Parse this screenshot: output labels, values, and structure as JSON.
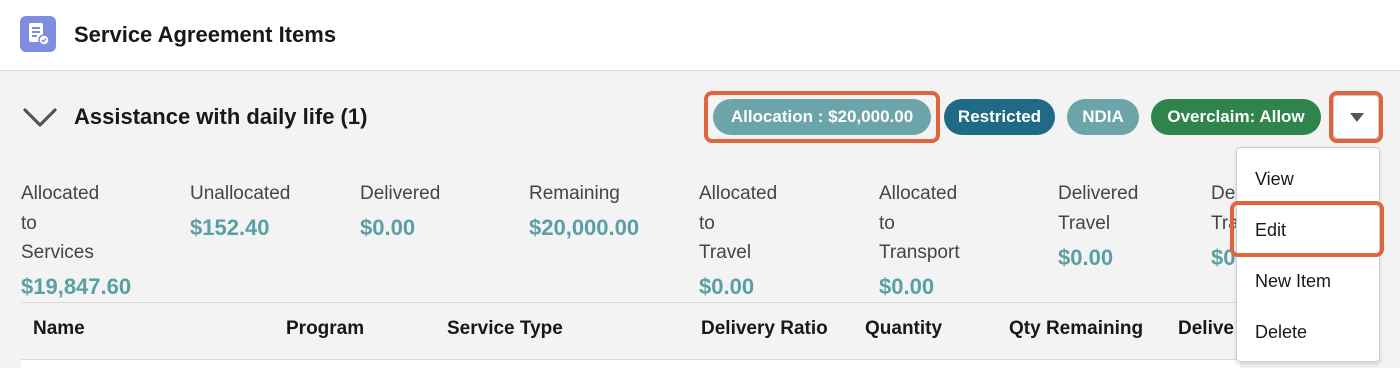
{
  "header": {
    "title": "Service Agreement Items",
    "icon": "service-agreement-icon",
    "icon_color": "#7f8de1"
  },
  "section": {
    "title": "Assistance with daily life (1)"
  },
  "badges": {
    "allocation": "Allocation : $20,000.00",
    "restricted": "Restricted",
    "ndia": "NDIA",
    "overclaim": "Overclaim: Allow"
  },
  "stats": {
    "allocated_services": {
      "label": [
        "Allocated",
        "to",
        "Services"
      ],
      "value": "$19,847.60"
    },
    "unallocated": {
      "label": "Unallocated",
      "value": "$152.40"
    },
    "delivered": {
      "label": "Delivered",
      "value": "$0.00"
    },
    "remaining": {
      "label": "Remaining",
      "value": "$20,000.00"
    },
    "allocated_travel": {
      "label": [
        "Allocated",
        "to",
        "Travel"
      ],
      "value": "$0.00"
    },
    "allocated_transport": {
      "label": [
        "Allocated",
        "to",
        "Transport"
      ],
      "value": "$0.00"
    },
    "delivered_travel": {
      "label": [
        "Delivered",
        "Travel"
      ],
      "value": "$0.00"
    },
    "partial": {
      "label": [
        "De",
        "Tra"
      ],
      "value": "$0"
    }
  },
  "table": {
    "columns": [
      "Name",
      "Program",
      "Service Type",
      "Delivery Ratio",
      "Quantity",
      "Qty Remaining",
      "Delive"
    ]
  },
  "menu": {
    "items": [
      "View",
      "Edit",
      "New Item",
      "Delete"
    ]
  },
  "colors": {
    "highlight": "#e1643d",
    "teal_badge": "#6ba5a9",
    "restricted_badge": "#1f6b86",
    "overclaim_badge": "#2e844a",
    "stat_value": "#5a9fa3"
  }
}
